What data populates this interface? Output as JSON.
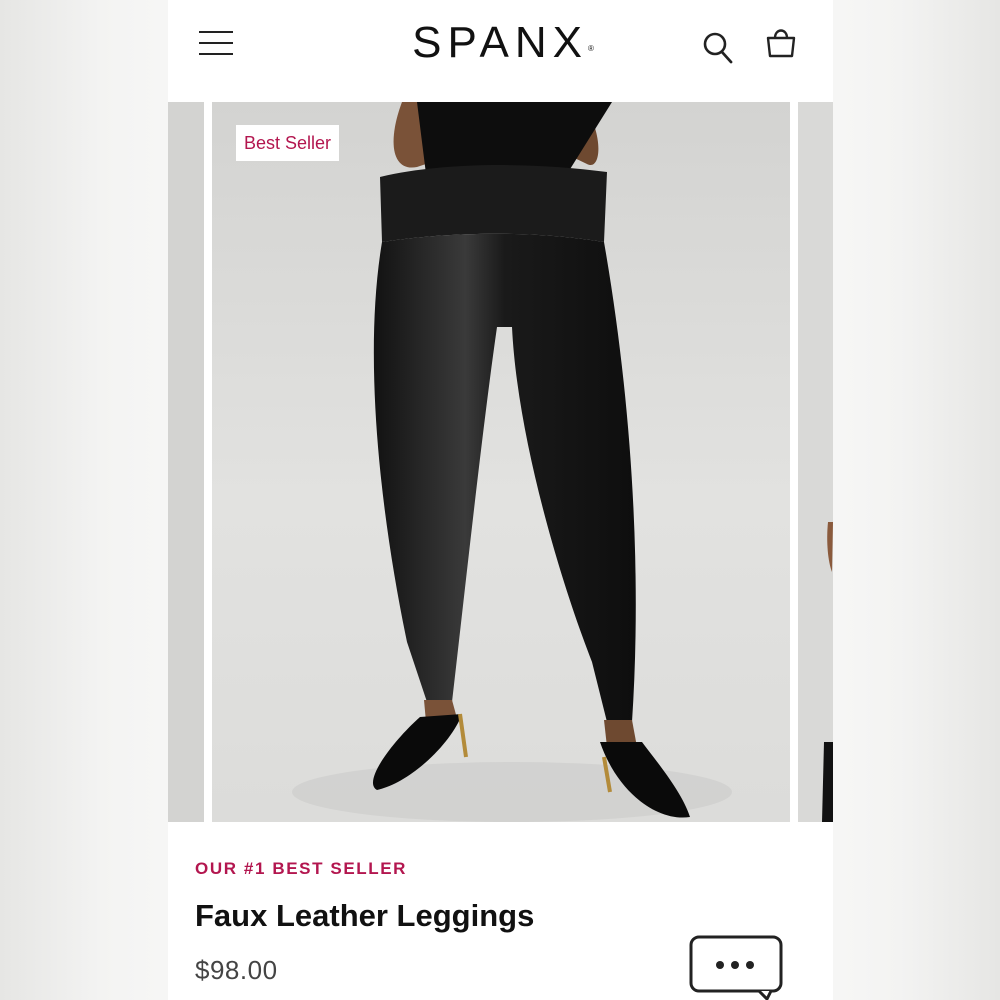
{
  "header": {
    "brand": "SPANX",
    "brand_mark": "®",
    "icons": {
      "menu": "hamburger-menu-icon",
      "search": "search-icon",
      "cart": "shopping-bag-icon"
    }
  },
  "carousel": {
    "badge": "Best Seller"
  },
  "product": {
    "eyebrow": "OUR #1 BEST SELLER",
    "name": "Faux Leather Leggings",
    "price": "$98.00"
  },
  "colors": {
    "accent": "#b3164f",
    "text": "#111111",
    "price": "#444444"
  }
}
